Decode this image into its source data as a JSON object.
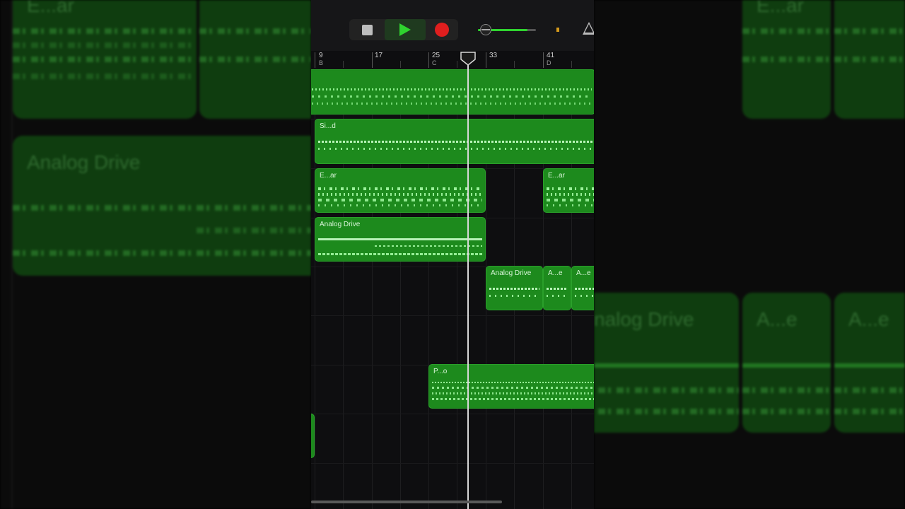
{
  "transport": {
    "stop_icon": "stop-icon",
    "play_icon": "play-icon",
    "record_icon": "record-icon",
    "metronome_icon": "metronome-icon",
    "volume_level": 0.85,
    "colors": {
      "play": "#2fd32f",
      "record": "#e01e1e",
      "region": "#1d8a1d"
    }
  },
  "ruler": {
    "bars": [
      "9",
      "17",
      "25",
      "33",
      "41"
    ],
    "sections": [
      "B",
      "C",
      "D"
    ]
  },
  "tracks": {
    "t2_region": "Si...d",
    "t3_region1": "E...ar",
    "t3_region2": "E...ar",
    "t4_region": "Analog Drive",
    "t5_region1": "Analog Drive",
    "t5_region2": "A...e",
    "t5_region3": "A...e",
    "t7_region": "P...o"
  },
  "background": {
    "left_top": "E...ar",
    "left_mid": "Analog Drive",
    "right_top": "E...ar",
    "right_mid1": "nalog Drive",
    "right_mid2": "A...e",
    "right_mid3": "A...e"
  }
}
